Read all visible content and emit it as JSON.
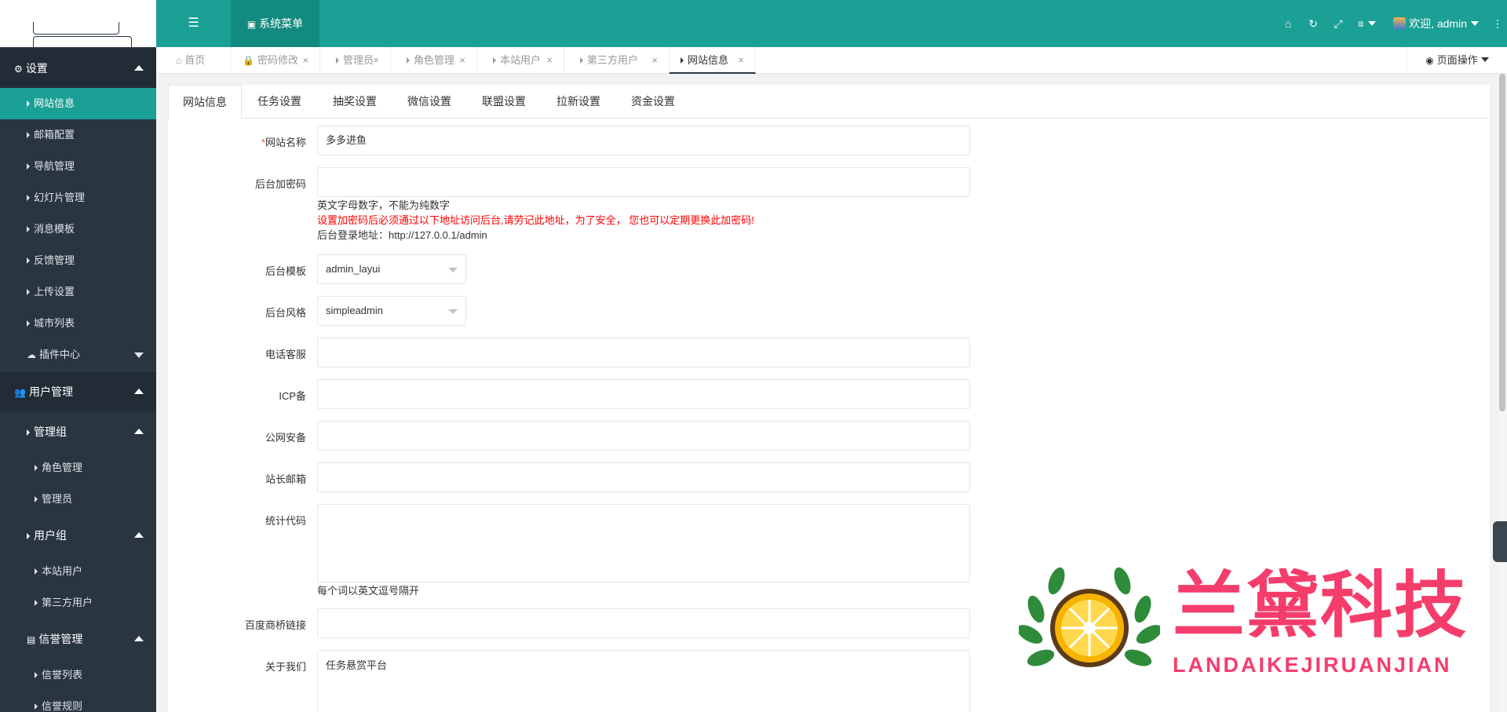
{
  "header": {
    "system_menu": "系统菜单",
    "welcome": "欢迎, admin"
  },
  "sidebar": {
    "settings_group": "设置",
    "settings_items": [
      "网站信息",
      "邮箱配置",
      "导航管理",
      "幻灯片管理",
      "消息模板",
      "反馈管理",
      "上传设置",
      "城市列表"
    ],
    "plugin_center": "插件中心",
    "user_mgmt_group": "用户管理",
    "admin_group": "管理组",
    "admin_items": [
      "角色管理",
      "管理员"
    ],
    "user_group": "用户组",
    "user_items": [
      "本站用户",
      "第三方用户"
    ],
    "credit_group": "信誉管理",
    "credit_items": [
      "信誉列表",
      "信誉规则"
    ]
  },
  "page_tabs": [
    "首页",
    "密码修改",
    "管理员",
    "角色管理",
    "本站用户",
    "第三方用户",
    "网站信息"
  ],
  "page_ops": "页面操作",
  "content_tabs": [
    "网站信息",
    "任务设置",
    "抽奖设置",
    "微信设置",
    "联盟设置",
    "拉新设置",
    "资金设置"
  ],
  "form": {
    "site_name_label": "网站名称",
    "site_name_value": "多多进鱼",
    "admin_pwd_label": "后台加密码",
    "admin_pwd_value": "",
    "admin_pwd_hint1": "英文字母数字，不能为纯数字",
    "admin_pwd_hint2": "设置加密码后必须通过以下地址访问后台,请劳记此地址，为了安全， 您也可以定期更换此加密码!",
    "admin_pwd_hint3": "后台登录地址：http://127.0.0.1/admin",
    "template_label": "后台模板",
    "template_value": "admin_layui",
    "style_label": "后台风格",
    "style_value": "simpleadmin",
    "phone_label": "电话客服",
    "icp_label": "ICP备",
    "police_label": "公网安备",
    "email_label": "站长邮箱",
    "stats_label": "统计代码",
    "stats_hint": "每个词以英文逗号隔开",
    "baidu_label": "百度商桥链接",
    "about_label": "关于我们",
    "about_value": "任务悬赏平台"
  },
  "watermark": {
    "title": "兰黛科技",
    "subtitle": "LANDAIKEJIRUANJIAN"
  },
  "colors": {
    "sidebar_bg": "#2a3542",
    "accent": "#1aa094",
    "watermark": "#f53d6b"
  }
}
